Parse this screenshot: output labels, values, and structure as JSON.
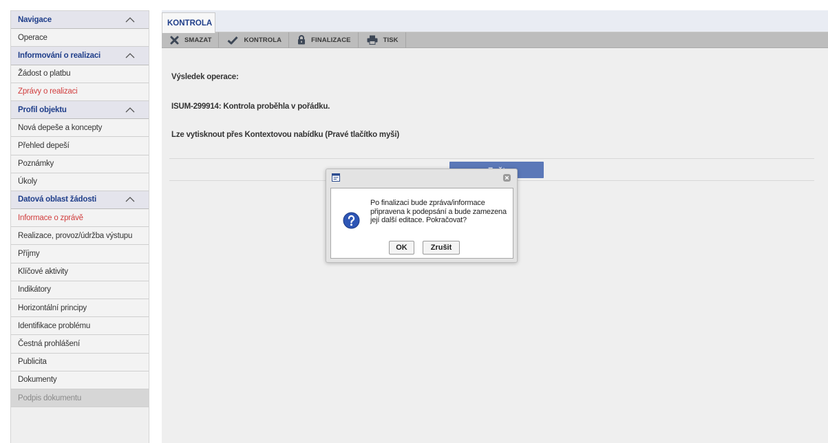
{
  "sidebar": {
    "nav_header": "Navigace",
    "operace": "Operace",
    "info_header": "Informování o realizaci",
    "zadost": "Žádost o platbu",
    "zpravy": "Zprávy o realizaci",
    "profil_header": "Profil objektu",
    "nova_depese": "Nová depeše a koncepty",
    "prehled": "Přehled depeší",
    "poznamky": "Poznámky",
    "ukoly": "Úkoly",
    "datova_header": "Datová oblast žádosti",
    "info_zprave": "Informace o zprávě",
    "realizace": "Realizace, provoz/údržba výstupu",
    "prijmy": "Příjmy",
    "klicove": "Klíčové aktivity",
    "indikatory": "Indikátory",
    "horizontalni": "Horizontální principy",
    "identifikace": "Identifikace problému",
    "cestna": "Čestná prohlášení",
    "publicita": "Publicita",
    "dokumenty": "Dokumenty",
    "podpis": "Podpis dokumentu"
  },
  "main": {
    "tab": "KONTROLA",
    "toolbar": {
      "smazat": "SMAZAT",
      "kontrola": "KONTROLA",
      "finalizace": "FINALIZACE",
      "tisk": "TISK"
    },
    "result_label": "Výsledek operace:",
    "result_message": "ISUM-299914: Kontrola proběhla v pořádku.",
    "print_hint": "Lze vytisknout přes Kontextovou nabídku (Pravé tlačítko myši)",
    "back_button": "Zpět"
  },
  "dialog": {
    "message": "Po finalizaci bude zpráva/informace připravena k podepsání a bude zamezena její další editace. Pokračovat?",
    "ok": "OK",
    "cancel": "Zrušit"
  },
  "colors": {
    "accent_blue": "#1f3e8a",
    "active_red": "#d13d3d",
    "button_blue": "#5b78b8"
  }
}
